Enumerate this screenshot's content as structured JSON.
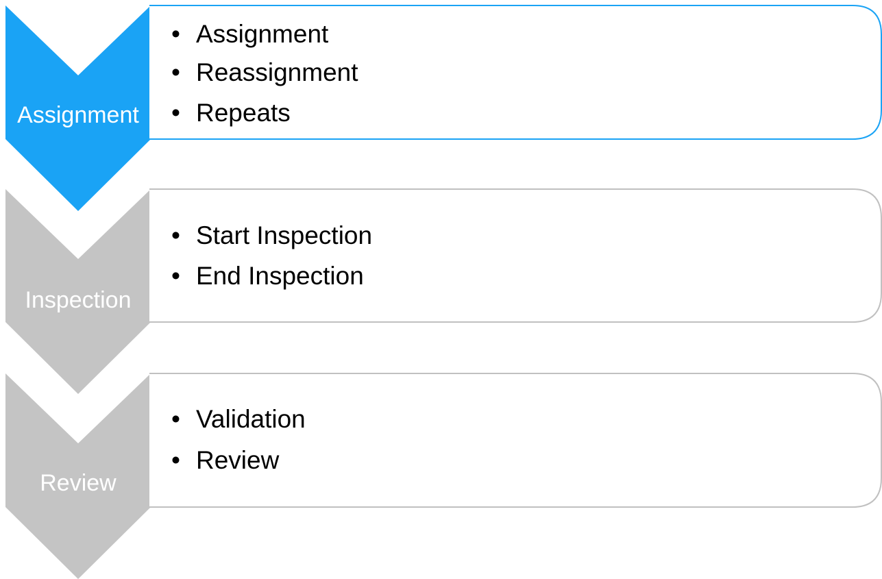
{
  "colors": {
    "active": "#1aa3f5",
    "inactive": "#c4c4c4",
    "active_border": "#1aa3f5",
    "inactive_border": "#c0c0c0",
    "bullet_text": "#000000",
    "chevron_text": "#ffffff"
  },
  "stages": [
    {
      "label": "Assignment",
      "active": true,
      "bullets": [
        "Assignment",
        "Reassignment",
        "Repeats"
      ]
    },
    {
      "label": "Inspection",
      "active": false,
      "bullets": [
        "Start Inspection",
        "End Inspection"
      ]
    },
    {
      "label": "Review",
      "active": false,
      "bullets": [
        "Validation",
        "Review"
      ]
    }
  ]
}
